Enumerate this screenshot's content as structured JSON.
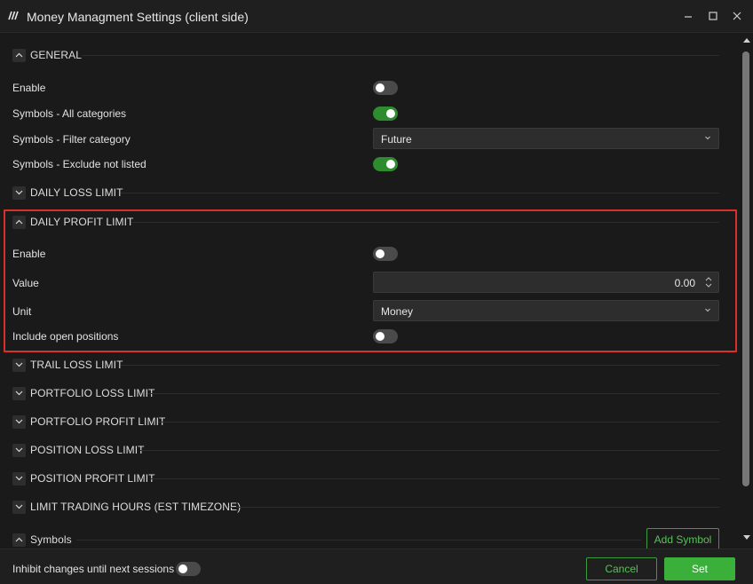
{
  "window": {
    "title": "Money Managment Settings (client side)",
    "logo_icon": "app-logo-stripes"
  },
  "colors": {
    "accent_green": "#3ab03a",
    "highlight_red": "#d9302a",
    "background": "#1a1a1a"
  },
  "sections": {
    "general": {
      "title": "GENERAL",
      "expanded": true,
      "rows": {
        "enable": {
          "label": "Enable",
          "value": false
        },
        "symbols_all": {
          "label": "Symbols - All categories",
          "value": true
        },
        "symbols_filter": {
          "label": "Symbols - Filter category",
          "value": "Future"
        },
        "symbols_exclude": {
          "label": "Symbols - Exclude not listed",
          "value": true
        }
      }
    },
    "daily_loss": {
      "title": "DAILY LOSS LIMIT",
      "expanded": false
    },
    "daily_profit": {
      "title": "DAILY PROFIT LIMIT",
      "expanded": true,
      "rows": {
        "enable": {
          "label": "Enable",
          "value": false
        },
        "value": {
          "label": "Value",
          "value": "0.00"
        },
        "unit": {
          "label": "Unit",
          "value": "Money"
        },
        "include_open": {
          "label": "Include open positions",
          "value": false
        }
      }
    },
    "trail_loss": {
      "title": "TRAIL LOSS LIMIT",
      "expanded": false
    },
    "portfolio_loss": {
      "title": "PORTFOLIO LOSS LIMIT",
      "expanded": false
    },
    "portfolio_profit": {
      "title": "PORTFOLIO PROFIT LIMIT",
      "expanded": false
    },
    "position_loss": {
      "title": "POSITION LOSS LIMIT",
      "expanded": false
    },
    "position_profit": {
      "title": "POSITION PROFIT LIMIT",
      "expanded": false
    },
    "limit_hours": {
      "title": "LIMIT TRADING HOURS (EST TIMEZONE)",
      "expanded": false
    },
    "symbols": {
      "title": "Symbols",
      "expanded": true,
      "add_label": "Add Symbol"
    }
  },
  "footer": {
    "inhibit_label": "Inhibit changes until next sessions",
    "inhibit_value": false,
    "cancel_label": "Cancel",
    "set_label": "Set"
  }
}
